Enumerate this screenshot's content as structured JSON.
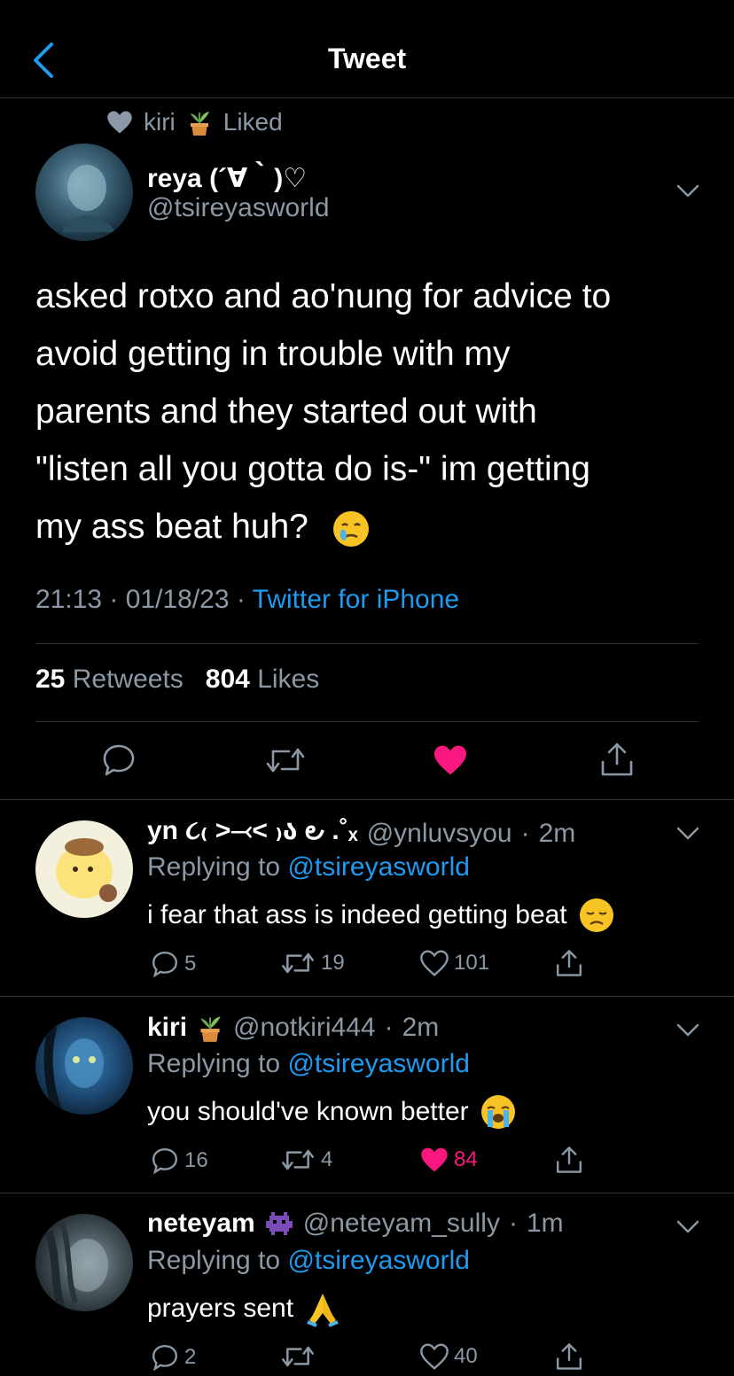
{
  "header": {
    "title": "Tweet"
  },
  "social_context": {
    "user": "kiri",
    "action": "Liked"
  },
  "tweet": {
    "display_name": "reya (´∀｀)♡",
    "handle": "@tsireyasworld",
    "lines": [
      "asked rotxo and ao'nung for advice to",
      "avoid getting in trouble with my",
      "parents and they started out with",
      "\"listen all you gotta do is-\" im getting",
      "my ass beat huh?"
    ],
    "time": "21:13",
    "date": "01/18/23",
    "source": "Twitter for iPhone",
    "retweets_count": "25",
    "retweets_label": "Retweets",
    "likes_count": "804",
    "likes_label": "Likes"
  },
  "replies": [
    {
      "display_name": "yn ૮₍ ˃⤙˂ ₎ა ౿ .˚ₓ",
      "handle": "@ynluvsyou",
      "time": "2m",
      "replying_prefix": "Replying to",
      "replying_to": "@tsireyasworld",
      "text": "i fear that ass is indeed getting beat",
      "reply_count": "5",
      "retweet_count": "19",
      "like_count": "101",
      "liked": false
    },
    {
      "display_name": "kiri",
      "handle": "@notkiri444",
      "time": "2m",
      "replying_prefix": "Replying to",
      "replying_to": "@tsireyasworld",
      "text": "you should've known better",
      "reply_count": "16",
      "retweet_count": "4",
      "like_count": "84",
      "liked": true
    },
    {
      "display_name": "neteyam",
      "handle": "@neteyam_sully",
      "time": "1m",
      "replying_prefix": "Replying to",
      "replying_to": "@tsireyasworld",
      "text": "prayers sent",
      "reply_count": "2",
      "retweet_count": "",
      "like_count": "40",
      "liked": false
    }
  ],
  "colors": {
    "accent": "#1d9bf0",
    "like": "#f91880",
    "muted": "#8b98a5",
    "divider": "#2f3336"
  }
}
